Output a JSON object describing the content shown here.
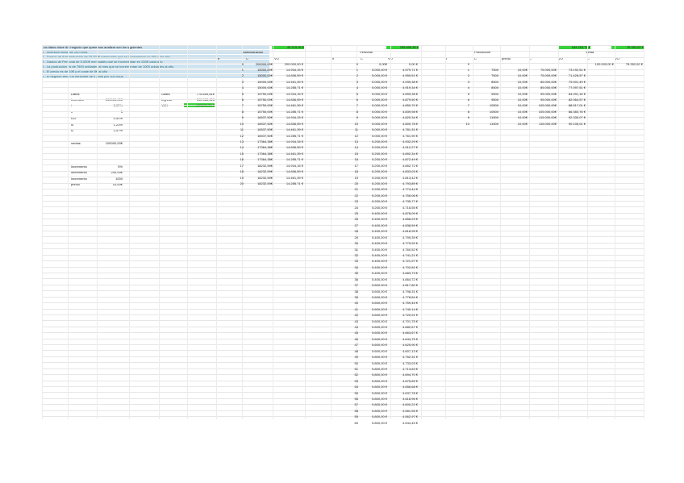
{
  "intro": [
    "Los datos clave del negocio que queremos analizar son los siguientes",
    "1 - Inversión inicial de 200.000€",
    "2 - Gastos de Administración de 15.000€ mensuales que se incrementan un 5% cada año",
    "3 - Gastos de Personal de 5.000€ mensuales que se incrementan en 200€ cada año",
    "4 - La producción es de 7500 unidades al mes que se incrementan de 1000 unidades al año",
    "5 - El precio es de 10€ y el coste de 5€ al año",
    "6 - El negocio tiene un horizonte de 5 años por 100.000€"
  ],
  "top_values": {
    "admin": "49.315,05 €",
    "personal": "295.896,35 €",
    "produccion": "184.318,71 €",
    "ventas": "76.353,62 €"
  },
  "sections": {
    "admin": "Administración",
    "personal": "Personal",
    "produccion": "Producción",
    "ventas": "Venta"
  },
  "col_labels": {
    "n": "n",
    "c": "C",
    "vo": "VO",
    "precio": "precio"
  },
  "datos": {
    "title": "Datos",
    "rows": [
      {
        "label": "inversión",
        "value": "200000,00€"
      },
      {
        "label": "i",
        "value": "5,00%"
      },
      {
        "label": "n",
        "value": "5"
      },
      {
        "label": "i/12",
        "value": "0,41%"
      },
      {
        "label": "i4",
        "value": "1,23%"
      },
      {
        "label": "i2",
        "value": "2,47%"
      }
    ],
    "ventas_label": "ventas",
    "ventas_value": "100000,00€",
    "inc_rows": [
      {
        "label": "incremento",
        "value": "5%"
      },
      {
        "label": "incremento",
        "value": "200,00€"
      },
      {
        "label": "incremento",
        "value": "1000"
      },
      {
        "label": "precio",
        "value": "10,00€"
      }
    ]
  },
  "summary": [
    {
      "label": "Gasto",
      "value": "776.659,81€"
    },
    {
      "label": "Ingreso",
      "value": "592.585,32€"
    },
    {
      "label": "VAN",
      "value": "-125695,51 €"
    }
  ],
  "admin_rows": [
    [
      "0",
      "200000,00€",
      "200.000,00 €"
    ],
    [
      "1",
      "15000,00€",
      "14.916,15 €"
    ],
    [
      "2",
      "15000,00€",
      "14.836,59 €"
    ],
    [
      "3",
      "15000,00€",
      "14.461,39 €"
    ],
    [
      "4",
      "15000,00€",
      "14.285,71 €"
    ],
    [
      "5",
      "15750,00€",
      "14.916,15 €"
    ],
    [
      "6",
      "15750,00€",
      "14.836,59 €"
    ],
    [
      "7",
      "15750,00€",
      "14.461,39 €"
    ],
    [
      "8",
      "15750,00€",
      "14.285,71 €"
    ],
    [
      "9",
      "16537,50€",
      "14.916,15 €"
    ],
    [
      "10",
      "16537,50€",
      "14.836,59 €"
    ],
    [
      "11",
      "16537,50€",
      "14.461,39 €"
    ],
    [
      "12",
      "16537,50€",
      "14.285,71 €"
    ],
    [
      "13",
      "17364,38€",
      "14.916,15 €"
    ],
    [
      "14",
      "17364,38€",
      "14.836,59 €"
    ],
    [
      "15",
      "17364,38€",
      "14.461,39 €"
    ],
    [
      "16",
      "17364,38€",
      "14.285,71 €"
    ],
    [
      "17",
      "18232,59€",
      "14.916,15 €"
    ],
    [
      "18",
      "18232,59€",
      "14.836,59 €"
    ],
    [
      "19",
      "18232,59€",
      "14.461,39 €"
    ],
    [
      "20",
      "18232,59€",
      "14.285,71 €"
    ]
  ],
  "personal_rows": [
    [
      "0",
      "0,00€",
      "0,00 €"
    ],
    [
      "1",
      "5.000,00 €",
      "4.979,71 €"
    ],
    [
      "2",
      "5.000,00 €",
      "4.959,51 €"
    ],
    [
      "3",
      "5.000,00 €",
      "4.939,38 €"
    ],
    [
      "4",
      "5.000,00 €",
      "4.919,34 €"
    ],
    [
      "5",
      "5.000,00 €",
      "4.899,38 €"
    ],
    [
      "6",
      "5.000,00 €",
      "4.879,50 €"
    ],
    [
      "7",
      "5.000,00 €",
      "4.859,70 €"
    ],
    [
      "8",
      "5.000,00 €",
      "4.839,98 €"
    ],
    [
      "9",
      "5.000,00 €",
      "4.820,34 €"
    ],
    [
      "10",
      "5.000,00 €",
      "4.800,78 €"
    ],
    [
      "11",
      "5.000,00 €",
      "4.781,31 €"
    ],
    [
      "12",
      "5.000,00 €",
      "4.761,90 €"
    ],
    [
      "13",
      "5.200,00 €",
      "4.932,29 €"
    ],
    [
      "14",
      "5.200,00 €",
      "4.912,27 €"
    ],
    [
      "15",
      "5.200,00 €",
      "4.892,34 €"
    ],
    [
      "16",
      "5.200,00 €",
      "4.872,49 €"
    ],
    [
      "17",
      "5.200,00 €",
      "4.852,72 €"
    ],
    [
      "18",
      "5.200,00 €",
      "4.833,03 €"
    ],
    [
      "19",
      "5.200,00 €",
      "4.813,42 €"
    ],
    [
      "20",
      "5.200,00 €",
      "4.793,89 €"
    ],
    [
      "21",
      "5.200,00 €",
      "4.774,44 €"
    ],
    [
      "22",
      "5.200,00 €",
      "4.755,06 €"
    ],
    [
      "23",
      "5.200,00 €",
      "4.735,77 €"
    ],
    [
      "24",
      "5.200,00 €",
      "4.716,55 €"
    ],
    [
      "25",
      "5.400,00 €",
      "4.878,09 €"
    ],
    [
      "26",
      "5.400,00 €",
      "4.858,29 €"
    ],
    [
      "27",
      "5.400,00 €",
      "4.838,59 €"
    ],
    [
      "28",
      "5.400,00 €",
      "4.818,95 €"
    ],
    [
      "29",
      "5.400,00 €",
      "4.799,39 €"
    ],
    [
      "30",
      "5.400,00 €",
      "4.779,92 €"
    ],
    [
      "31",
      "5.400,00 €",
      "4.760,52 €"
    ],
    [
      "32",
      "5.400,00 €",
      "4.741,21 €"
    ],
    [
      "33",
      "5.400,00 €",
      "4.721,97 €"
    ],
    [
      "34",
      "5.400,00 €",
      "4.702,81 €"
    ],
    [
      "35",
      "5.400,00 €",
      "4.683,73 €"
    ],
    [
      "36",
      "5.400,00 €",
      "4.664,72 €"
    ],
    [
      "37",
      "5.600,00 €",
      "4.817,80 €"
    ],
    [
      "38",
      "5.600,00 €",
      "4.798,31 €"
    ],
    [
      "39",
      "5.600,00 €",
      "4.778,84 €"
    ],
    [
      "40",
      "5.600,00 €",
      "4.759,45 €"
    ],
    [
      "41",
      "5.600,00 €",
      "4.740,14 €"
    ],
    [
      "42",
      "5.600,00 €",
      "4.720,91 €"
    ],
    [
      "43",
      "5.600,00 €",
      "4.701,75 €"
    ],
    [
      "44",
      "5.600,00 €",
      "4.682,67 €"
    ],
    [
      "45",
      "5.600,00 €",
      "4.663,67 €"
    ],
    [
      "46",
      "5.600,00 €",
      "4.644,75 €"
    ],
    [
      "47",
      "5.600,00 €",
      "4.625,90 €"
    ],
    [
      "48",
      "5.600,00 €",
      "4.607,13 €"
    ],
    [
      "49",
      "5.800,00 €",
      "4.752,31 €"
    ],
    [
      "50",
      "5.800,00 €",
      "4.733,03 €"
    ],
    [
      "51",
      "5.800,00 €",
      "4.713,83 €"
    ],
    [
      "52",
      "5.800,00 €",
      "4.694,70 €"
    ],
    [
      "53",
      "5.800,00 €",
      "4.675,65 €"
    ],
    [
      "54",
      "5.800,00 €",
      "4.656,68 €"
    ],
    [
      "55",
      "5.800,00 €",
      "4.637,78 €"
    ],
    [
      "56",
      "5.800,00 €",
      "4.618,96 €"
    ],
    [
      "57",
      "5.800,00 €",
      "4.600,22 €"
    ],
    [
      "58",
      "5.800,00 €",
      "4.581,55 €"
    ],
    [
      "59",
      "5.800,00 €",
      "4.562,97 €"
    ],
    [
      "60",
      "5.800,00 €",
      "4.544,45 €"
    ]
  ],
  "produccion_rows": [
    [
      "0",
      "",
      "",
      "",
      ""
    ],
    [
      "1",
      "7500",
      "10,00€",
      "75.000,00€",
      "73.192,51 €"
    ],
    [
      "2",
      "7500",
      "10,00€",
      "75.000,00€",
      "71.428,57 €"
    ],
    [
      "3",
      "8500",
      "10,00€",
      "85.000,00€",
      "79.001,49 €"
    ],
    [
      "4",
      "8500",
      "10,00€",
      "85.000,00€",
      "77.097,51 €"
    ],
    [
      "5",
      "9500",
      "10,00€",
      "95.000,00€",
      "84.091,16 €"
    ],
    [
      "6",
      "9500",
      "10,00€",
      "95.000,00€",
      "82.064,57 €"
    ],
    [
      "7",
      "10500",
      "10,00€",
      "105.000,00€",
      "88.517,01 €"
    ],
    [
      "8",
      "10500",
      "10,00€",
      "105.000,00€",
      "86.383,76 €"
    ],
    [
      "9",
      "11500",
      "10,00€",
      "115.000,00€",
      "92.330,07 €"
    ],
    [
      "10",
      "11500",
      "10,00€",
      "115.000,00€",
      "90.105,01 €"
    ]
  ],
  "ventas_rows": [
    [
      "100.000,00 €",
      "78.352,62 €"
    ]
  ]
}
